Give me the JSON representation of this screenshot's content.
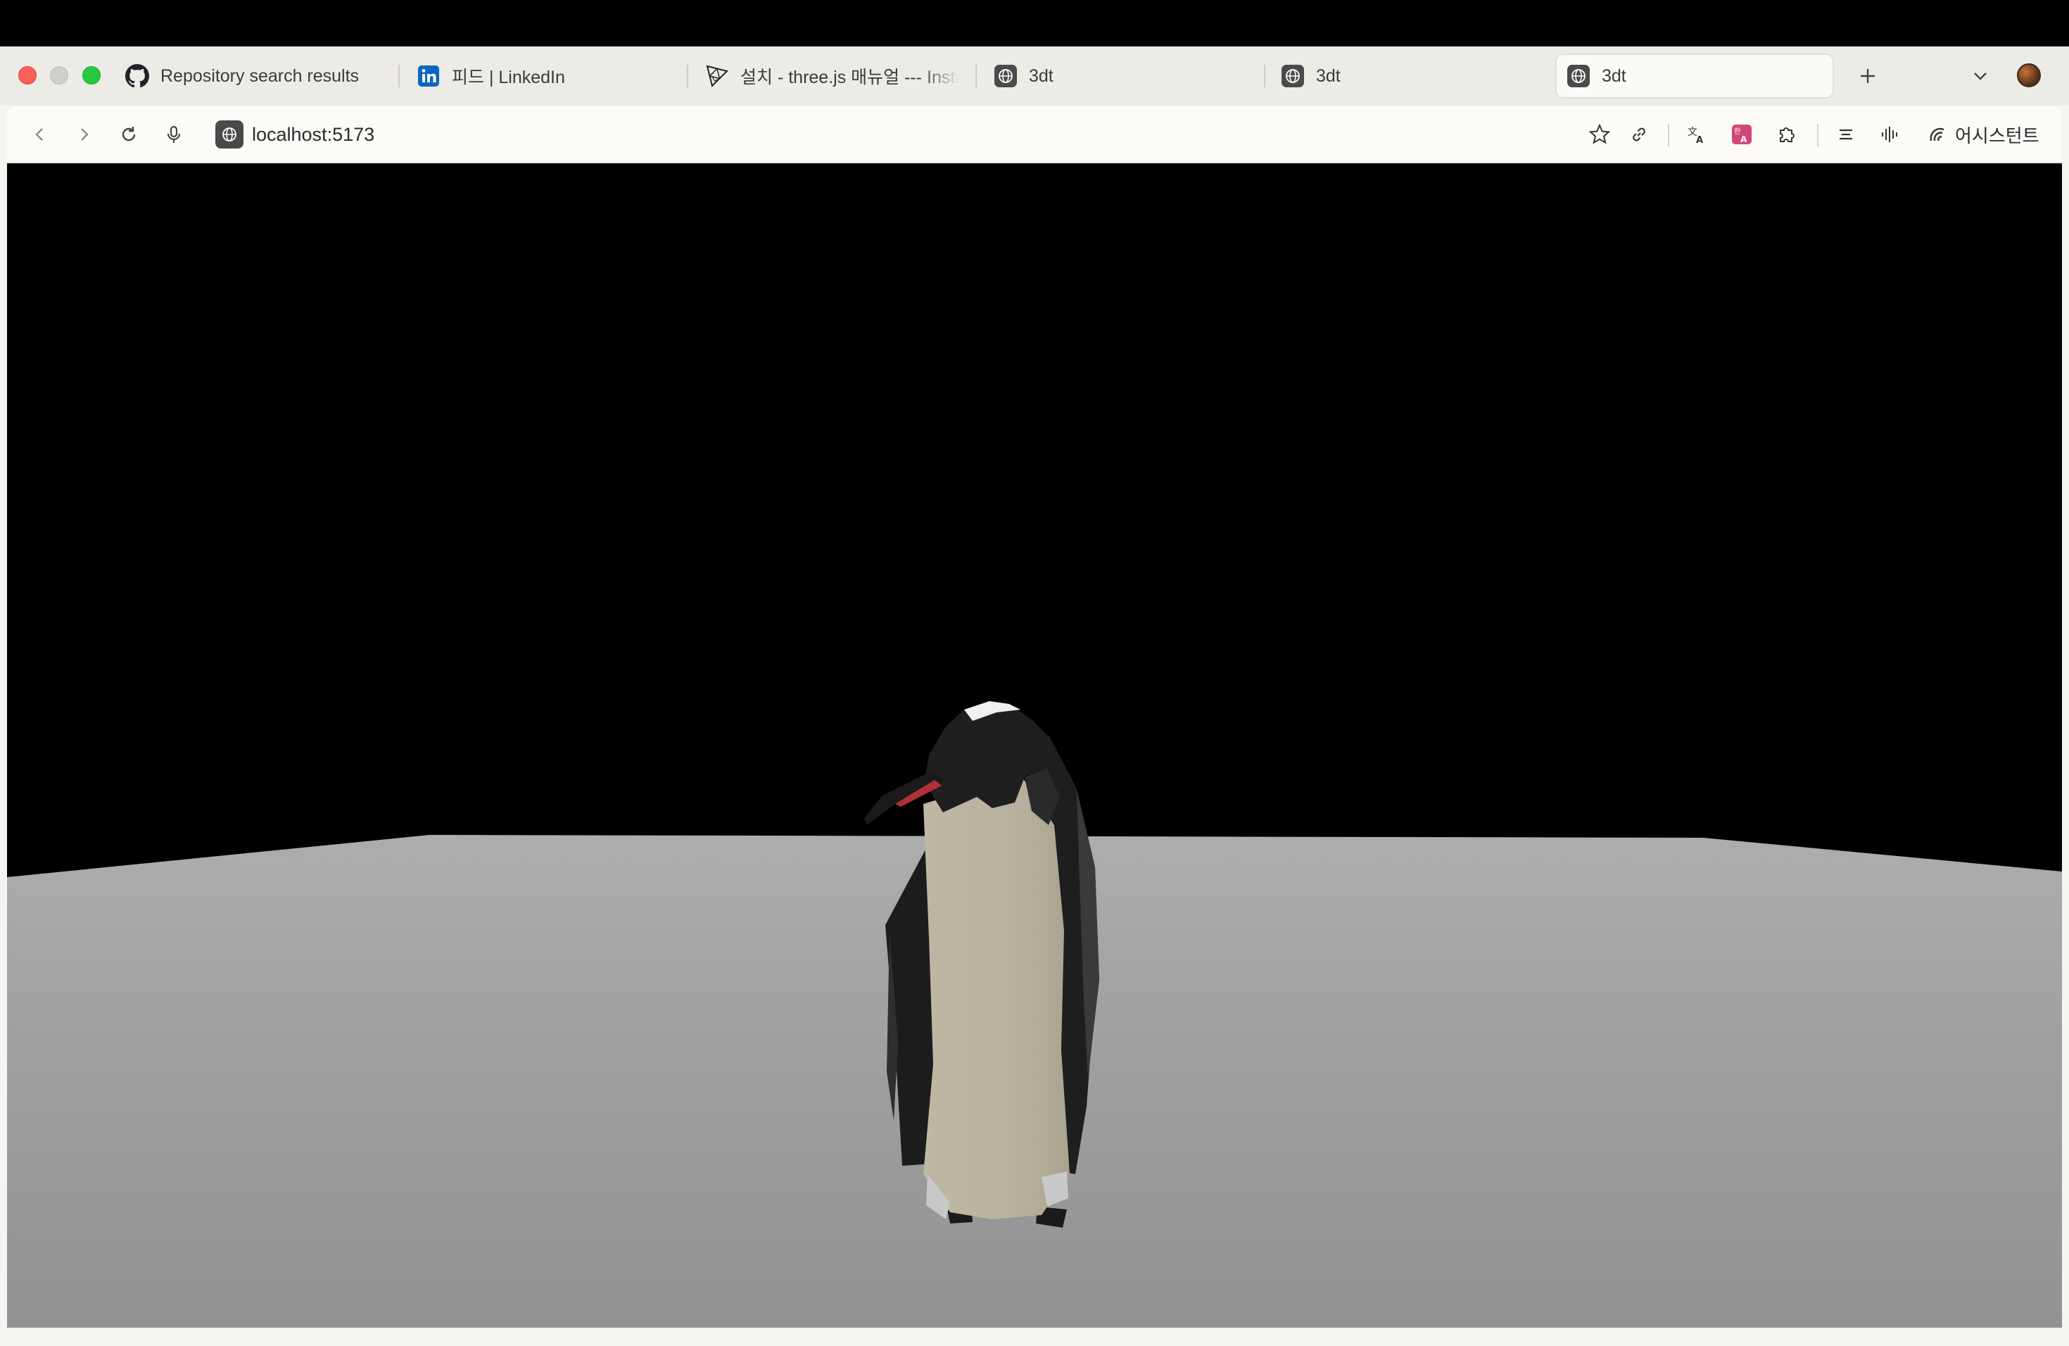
{
  "browser": {
    "tabs": [
      {
        "title": "Repository search results",
        "favicon": "github-icon",
        "active": false
      },
      {
        "title": "피드 | LinkedIn",
        "favicon": "linkedin-icon",
        "active": false
      },
      {
        "title": "설치 - three.js 매뉴얼 --- Insta",
        "favicon": "threejs-icon",
        "active": false
      },
      {
        "title": "3dt",
        "favicon": "globe-icon",
        "active": false
      },
      {
        "title": "3dt",
        "favicon": "globe-icon",
        "active": false
      },
      {
        "title": "3dt",
        "favicon": "globe-icon",
        "active": true
      }
    ],
    "url": "localhost:5173",
    "assistant_label": "어시스턴트",
    "toolbar_icons": [
      "back-icon",
      "forward-icon",
      "reload-icon",
      "microphone-icon",
      "star-icon",
      "link-icon",
      "translate-icon",
      "korean-translate-icon",
      "extensions-icon",
      "reader-icon",
      "audio-icon",
      "assistant-icon"
    ]
  },
  "scene": {
    "background_color": "#000000",
    "ground_color": "#9a9a9a",
    "subject": "penguin-model"
  }
}
